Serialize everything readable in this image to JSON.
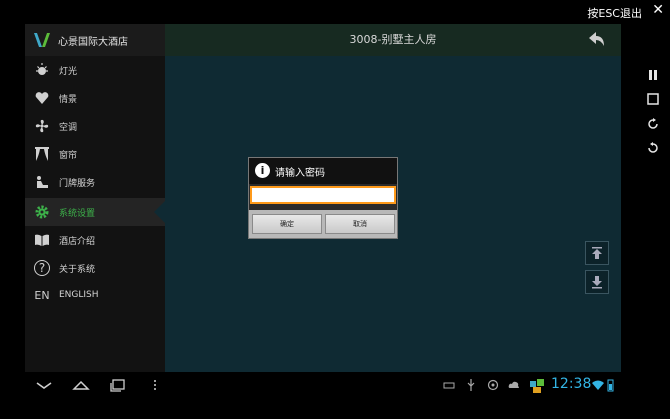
{
  "emulator": {
    "esc_label": "按ESC退出",
    "close_glyph": "✕"
  },
  "header": {
    "hotel_name": "心景国际大酒店",
    "room_title": "3008-别墅主人房"
  },
  "sidebar": {
    "items": [
      {
        "label": "灯光",
        "icon": "light-icon"
      },
      {
        "label": "情景",
        "icon": "heart-icon"
      },
      {
        "label": "空调",
        "icon": "fan-icon"
      },
      {
        "label": "窗帘",
        "icon": "curtain-icon"
      },
      {
        "label": "门牌服务",
        "icon": "service-icon"
      },
      {
        "label": "系统设置",
        "icon": "gear-icon",
        "active": true
      },
      {
        "label": "酒店介绍",
        "icon": "book-icon"
      },
      {
        "label": "关于系统",
        "icon": "help-icon",
        "glyph": "?"
      },
      {
        "label": "ENGLISH",
        "icon": "language-icon",
        "glyph": "EN"
      }
    ]
  },
  "dialog": {
    "title": "请输入密码",
    "input_value": "",
    "ok_label": "确定",
    "cancel_label": "取消"
  },
  "statusbar": {
    "clock": "12:38"
  },
  "colors": {
    "accent": "#3db24a",
    "clock": "#33b5e5",
    "focus": "#ff9a1a"
  }
}
